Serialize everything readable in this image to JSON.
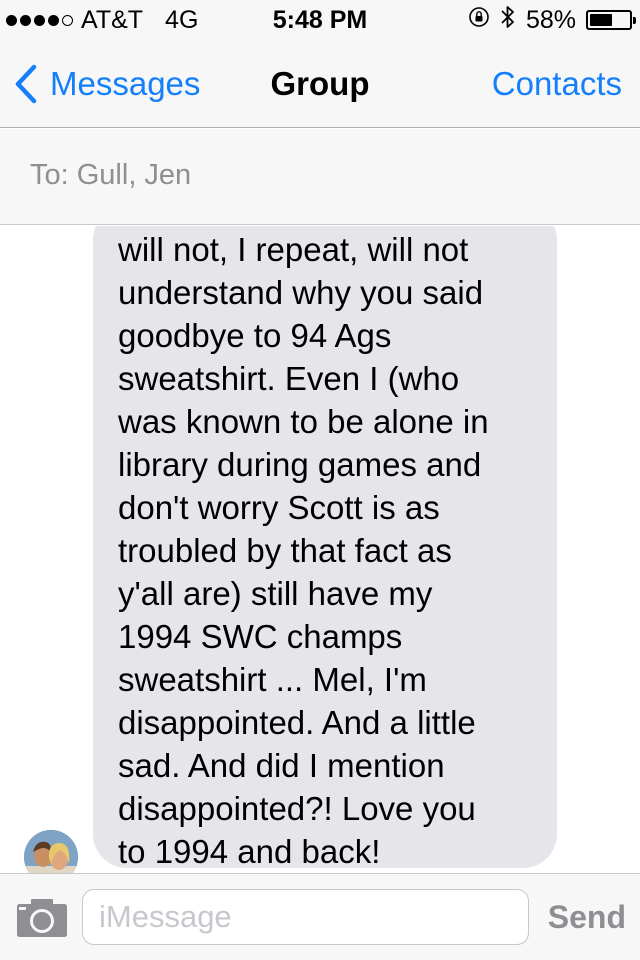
{
  "status_bar": {
    "signal_bars_filled": 4,
    "signal_bars_total": 5,
    "carrier": "AT&T",
    "network": "4G",
    "time": "5:48 PM",
    "battery_percent_label": "58%",
    "battery_level": 0.58,
    "icons": [
      "orientation-lock-icon",
      "bluetooth-icon",
      "battery-icon"
    ]
  },
  "nav": {
    "back_label": "Messages",
    "title": "Group",
    "right_label": "Contacts",
    "accent_color": "#157efb"
  },
  "recipients": {
    "label": "To: Gull, Jen"
  },
  "messages": [
    {
      "direction": "incoming",
      "text": "will not, I repeat, will not\nunderstand why you said\ngoodbye to 94 Ags\nsweatshirt. Even I (who\nwas known to be alone in\nlibrary during games and\ndon't worry Scott is as\ntroubled by that fact as\ny'all are) still have my\n1994 SWC champs\nsweatshirt ... Mel, I'm\ndisappointed. And a little\nsad. And did I mention\ndisappointed?! Love you\nto 1994 and back!",
      "bubble_color": "#e5e5ea"
    }
  ],
  "compose": {
    "placeholder": "iMessage",
    "value": "",
    "send_label": "Send",
    "camera_icon": "camera-icon"
  }
}
